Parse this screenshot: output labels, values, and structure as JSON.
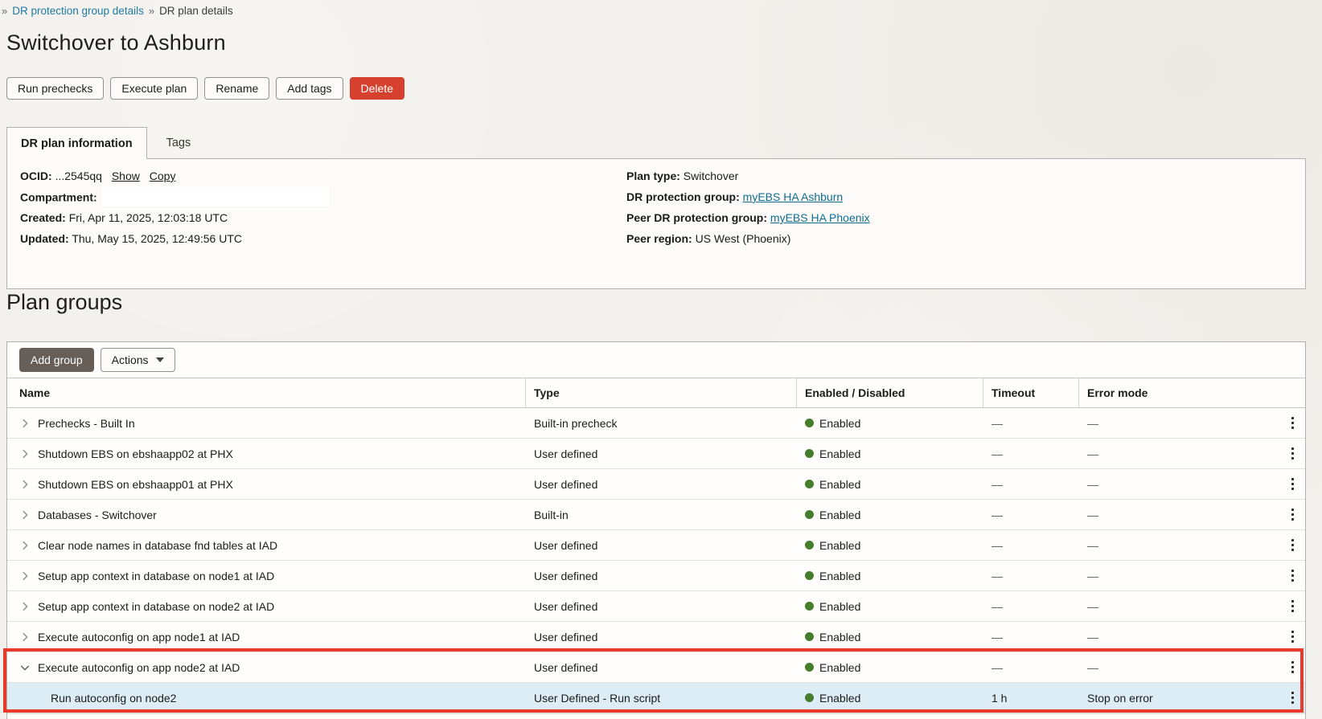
{
  "breadcrumb": {
    "leading_separator": "»",
    "link": "DR protection group details",
    "separator": "»",
    "current": "DR plan details"
  },
  "page": {
    "title": "Switchover to Ashburn"
  },
  "header_actions": {
    "run_prechecks": "Run prechecks",
    "execute_plan": "Execute plan",
    "rename": "Rename",
    "add_tags": "Add tags",
    "delete": "Delete"
  },
  "tabs": {
    "info": "DR plan information",
    "tags": "Tags"
  },
  "info": {
    "ocid_label": "OCID:",
    "ocid_value": "...2545qq",
    "show_link": "Show",
    "copy_link": "Copy",
    "compartment_label": "Compartment:",
    "compartment_value": "",
    "created_label": "Created:",
    "created_value": "Fri, Apr 11, 2025, 12:03:18 UTC",
    "updated_label": "Updated:",
    "updated_value": "Thu, May 15, 2025, 12:49:56 UTC",
    "plan_type_label": "Plan type:",
    "plan_type_value": "Switchover",
    "dr_group_label": "DR protection group:",
    "dr_group_value": "myEBS HA Ashburn",
    "peer_group_label": "Peer DR protection group:",
    "peer_group_value": "myEBS HA Phoenix",
    "peer_region_label": "Peer region:",
    "peer_region_value": "US West (Phoenix)"
  },
  "plan_groups": {
    "heading": "Plan groups",
    "add_group_button": "Add group",
    "actions_button": "Actions",
    "columns": {
      "name": "Name",
      "type": "Type",
      "status": "Enabled / Disabled",
      "timeout": "Timeout",
      "error_mode": "Error mode"
    },
    "rows": [
      {
        "name": "Prechecks - Built In",
        "type": "Built-in precheck",
        "status": "Enabled",
        "timeout": "—",
        "error_mode": "—",
        "level": 0,
        "expanded": false,
        "highlight": false
      },
      {
        "name": "Shutdown EBS on ebshaapp02 at PHX",
        "type": "User defined",
        "status": "Enabled",
        "timeout": "—",
        "error_mode": "—",
        "level": 0,
        "expanded": false,
        "highlight": false
      },
      {
        "name": "Shutdown EBS on ebshaapp01 at PHX",
        "type": "User defined",
        "status": "Enabled",
        "timeout": "—",
        "error_mode": "—",
        "level": 0,
        "expanded": false,
        "highlight": false
      },
      {
        "name": "Databases - Switchover",
        "type": "Built-in",
        "status": "Enabled",
        "timeout": "—",
        "error_mode": "—",
        "level": 0,
        "expanded": false,
        "highlight": false
      },
      {
        "name": "Clear node names in database fnd tables at IAD",
        "type": "User defined",
        "status": "Enabled",
        "timeout": "—",
        "error_mode": "—",
        "level": 0,
        "expanded": false,
        "highlight": false
      },
      {
        "name": "Setup app context in database on node1 at IAD",
        "type": "User defined",
        "status": "Enabled",
        "timeout": "—",
        "error_mode": "—",
        "level": 0,
        "expanded": false,
        "highlight": false
      },
      {
        "name": "Setup app context in database on node2 at IAD",
        "type": "User defined",
        "status": "Enabled",
        "timeout": "—",
        "error_mode": "—",
        "level": 0,
        "expanded": false,
        "highlight": false
      },
      {
        "name": "Execute autoconfig on app node1 at IAD",
        "type": "User defined",
        "status": "Enabled",
        "timeout": "—",
        "error_mode": "—",
        "level": 0,
        "expanded": false,
        "highlight": false
      },
      {
        "name": "Execute autoconfig on app node2 at IAD",
        "type": "User defined",
        "status": "Enabled",
        "timeout": "—",
        "error_mode": "—",
        "level": 0,
        "expanded": true,
        "highlight": false
      },
      {
        "name": "Run autoconfig on node2",
        "type": "User Defined - Run script",
        "status": "Enabled",
        "timeout": "1 h",
        "error_mode": "Stop on error",
        "level": 1,
        "expanded": null,
        "highlight": true
      }
    ]
  },
  "colors": {
    "accent_link": "#1f7a9e",
    "danger_button": "#d5412e",
    "primary_button": "#665e57",
    "status_enabled_dot": "#447d2c",
    "highlight_row": "#ddedf6",
    "annotation_box": "#e8392b"
  }
}
